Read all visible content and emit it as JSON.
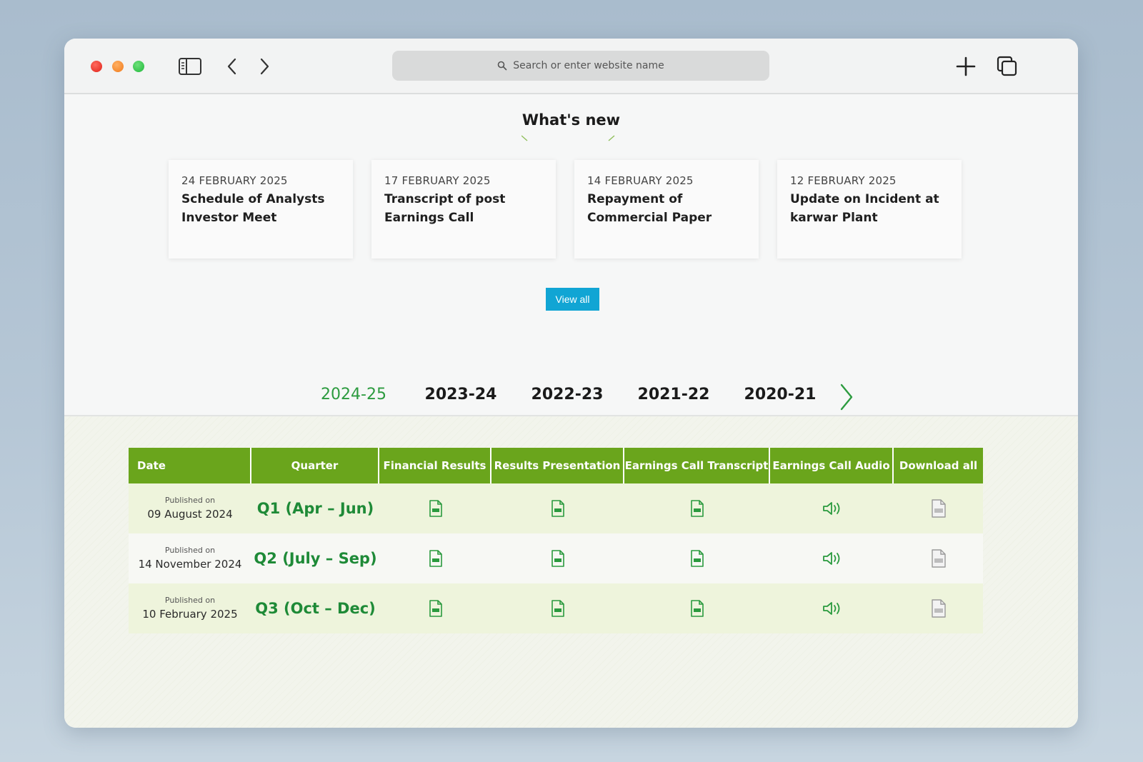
{
  "browser": {
    "address_placeholder": "Search or enter website name"
  },
  "whats_new": {
    "title": "What's new",
    "items": [
      {
        "date": "24 FEBRUARY 2025",
        "title": "Schedule of Analysts Investor Meet"
      },
      {
        "date": "17 FEBRUARY 2025",
        "title": "Transcript of post Earnings Call"
      },
      {
        "date": "14 FEBRUARY 2025",
        "title": "Repayment of Commercial Paper"
      },
      {
        "date": "12 FEBRUARY 2025",
        "title": "Update on Incident at karwar Plant"
      }
    ],
    "view_all_label": "View all"
  },
  "years": {
    "items": [
      "2024-25",
      "2023-24",
      "2022-23",
      "2021-22",
      "2020-21"
    ],
    "active": "2024-25"
  },
  "table": {
    "headers": [
      "Date",
      "Quarter",
      "Financial Results",
      "Results Presentation",
      "Earnings Call Transcript",
      "Earnings Call Audio",
      "Download all"
    ],
    "rows": [
      {
        "published_label": "Published on",
        "date": "09 August 2024",
        "quarter": "Q1 (Apr – Jun)"
      },
      {
        "published_label": "Published on",
        "date": "14 November 2024",
        "quarter": "Q2 (July – Sep)"
      },
      {
        "published_label": "Published on",
        "date": "10 February 2025",
        "quarter": "Q3 (Oct – Dec)"
      }
    ],
    "icons": {
      "financial_results": "pdf-icon",
      "results_presentation": "pdf-icon",
      "earnings_call_transcript": "pdf-icon",
      "earnings_call_audio": "speaker-icon",
      "download_all": "zip-icon"
    }
  },
  "colors": {
    "header_green": "#6aa51c",
    "accent_green": "#2c9b3f",
    "button_blue": "#11a5d4"
  }
}
